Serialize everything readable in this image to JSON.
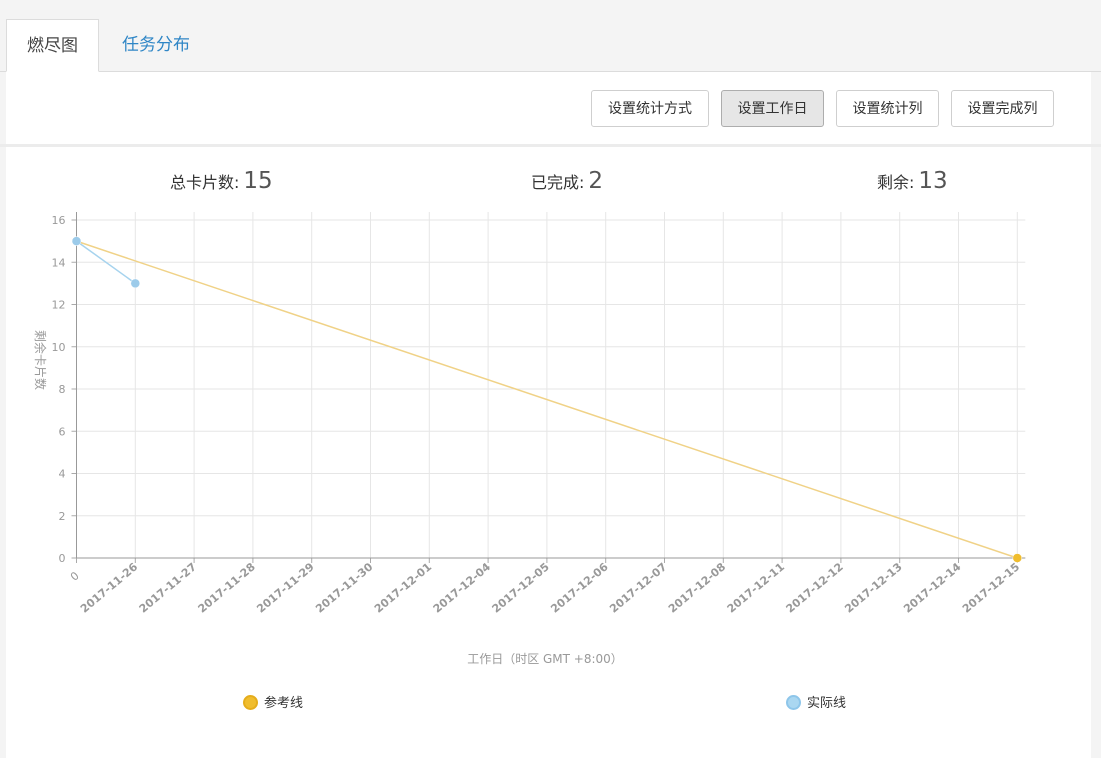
{
  "tabs": [
    {
      "label": "燃尽图",
      "active": true
    },
    {
      "label": "任务分布",
      "active": false
    }
  ],
  "toolbar": {
    "buttons": [
      {
        "label": "设置统计方式"
      },
      {
        "label": "设置工作日"
      },
      {
        "label": "设置统计列"
      },
      {
        "label": "设置完成列"
      }
    ]
  },
  "stats": {
    "total_label": "总卡片数:",
    "total_value": "15",
    "done_label": "已完成:",
    "done_value": "2",
    "remaining_label": "剩余:",
    "remaining_value": "13"
  },
  "chart_data": {
    "type": "line",
    "ylabel": "剩余卡片数",
    "xlabel": "工作日（时区 GMT +8:00）",
    "ylim": [
      0,
      16
    ],
    "yticks": [
      0,
      2,
      4,
      6,
      8,
      10,
      12,
      14,
      16
    ],
    "categories": [
      "0",
      "2017-11-26",
      "2017-11-27",
      "2017-11-28",
      "2017-11-29",
      "2017-11-30",
      "2017-12-01",
      "2017-12-04",
      "2017-12-05",
      "2017-12-06",
      "2017-12-07",
      "2017-12-08",
      "2017-12-11",
      "2017-12-12",
      "2017-12-13",
      "2017-12-14",
      "2017-12-15"
    ],
    "grid": true,
    "legend_position": "bottom",
    "series": [
      {
        "name": "参考线",
        "color": "#f0d287",
        "marker_color": "#f0bd2e",
        "values": [
          15,
          null,
          null,
          null,
          null,
          null,
          null,
          null,
          null,
          null,
          null,
          null,
          null,
          null,
          null,
          null,
          0
        ]
      },
      {
        "name": "实际线",
        "color": "#a6d3ee",
        "marker_color": "#9ccbea",
        "values": [
          15,
          13,
          null,
          null,
          null,
          null,
          null,
          null,
          null,
          null,
          null,
          null,
          null,
          null,
          null,
          null,
          null
        ]
      }
    ]
  }
}
